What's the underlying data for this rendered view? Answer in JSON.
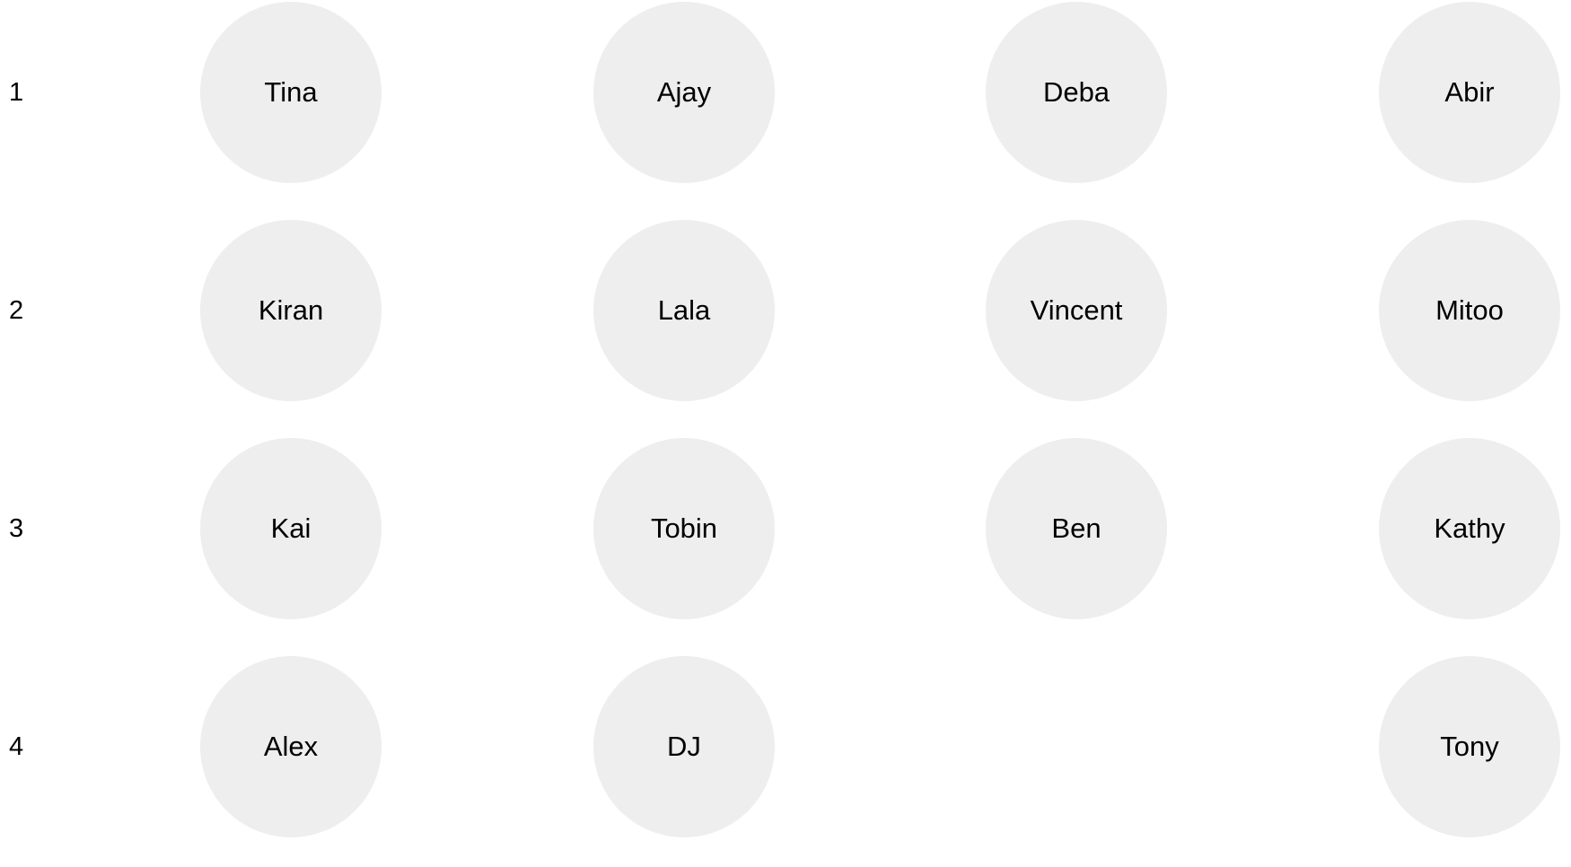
{
  "rows": [
    {
      "label": "1",
      "seats": [
        "Tina",
        "Ajay",
        "Deba",
        "Abir"
      ]
    },
    {
      "label": "2",
      "seats": [
        "Kiran",
        "Lala",
        "Vincent",
        "Mitoo"
      ]
    },
    {
      "label": "3",
      "seats": [
        "Kai",
        "Tobin",
        "Ben",
        "Kathy"
      ]
    },
    {
      "label": "4",
      "seats": [
        "Alex",
        "DJ",
        "",
        "Tony"
      ]
    }
  ],
  "colors": {
    "seat_fill": "#eeeeee",
    "text": "#000000",
    "background": "#ffffff"
  }
}
